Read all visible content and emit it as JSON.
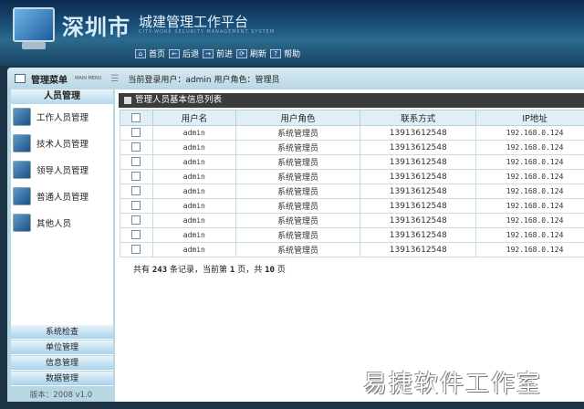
{
  "header": {
    "city": "深圳市",
    "platform": "城建管理工作平台",
    "platform_en": "CITY-WORK SECURITY MANAGEMENT SYSTEM",
    "nav": [
      {
        "icon": "home-icon",
        "glyph": "⌂",
        "label": "首页"
      },
      {
        "icon": "back-icon",
        "glyph": "←",
        "label": "后退"
      },
      {
        "icon": "forward-icon",
        "glyph": "→",
        "label": "前进"
      },
      {
        "icon": "refresh-icon",
        "glyph": "⟳",
        "label": "刷新"
      },
      {
        "icon": "help-icon",
        "glyph": "?",
        "label": "帮助"
      }
    ]
  },
  "menubar": {
    "title": "管理菜单",
    "title_en": "MAIN MENU",
    "login": "当前登录用户：admin  用户角色：管理员"
  },
  "sidebar": {
    "section": "人员管理",
    "items": [
      "工作人员管理",
      "技术人员管理",
      "领导人员管理",
      "普通人员管理",
      "其他人员"
    ],
    "buttons": [
      "系统检查",
      "单位管理",
      "信息管理",
      "数据管理"
    ],
    "version": "版本：2008 v1.0"
  },
  "main": {
    "title": "管理人员基本信息列表",
    "columns": [
      "用户名",
      "用户角色",
      "联系方式",
      "IP地址"
    ],
    "rows": [
      [
        "admin",
        "系统管理员",
        "13913612548",
        "192.168.0.124"
      ],
      [
        "admin",
        "系统管理员",
        "13913612548",
        "192.168.0.124"
      ],
      [
        "admin",
        "系统管理员",
        "13913612548",
        "192.168.0.124"
      ],
      [
        "admin",
        "系统管理员",
        "13913612548",
        "192.168.0.124"
      ],
      [
        "admin",
        "系统管理员",
        "13913612548",
        "192.168.0.124"
      ],
      [
        "admin",
        "系统管理员",
        "13913612548",
        "192.168.0.124"
      ],
      [
        "admin",
        "系统管理员",
        "13913612548",
        "192.168.0.124"
      ],
      [
        "admin",
        "系统管理员",
        "13913612548",
        "192.168.0.124"
      ],
      [
        "admin",
        "系统管理员",
        "13913612548",
        "192.168.0.124"
      ]
    ],
    "pager": {
      "p1": "共有",
      "total": "243",
      "p2": "条记录，当前第",
      "current": "1",
      "p3": "页，共",
      "pages": "10",
      "p4": "页"
    }
  },
  "watermark": "易捷软件工作室"
}
